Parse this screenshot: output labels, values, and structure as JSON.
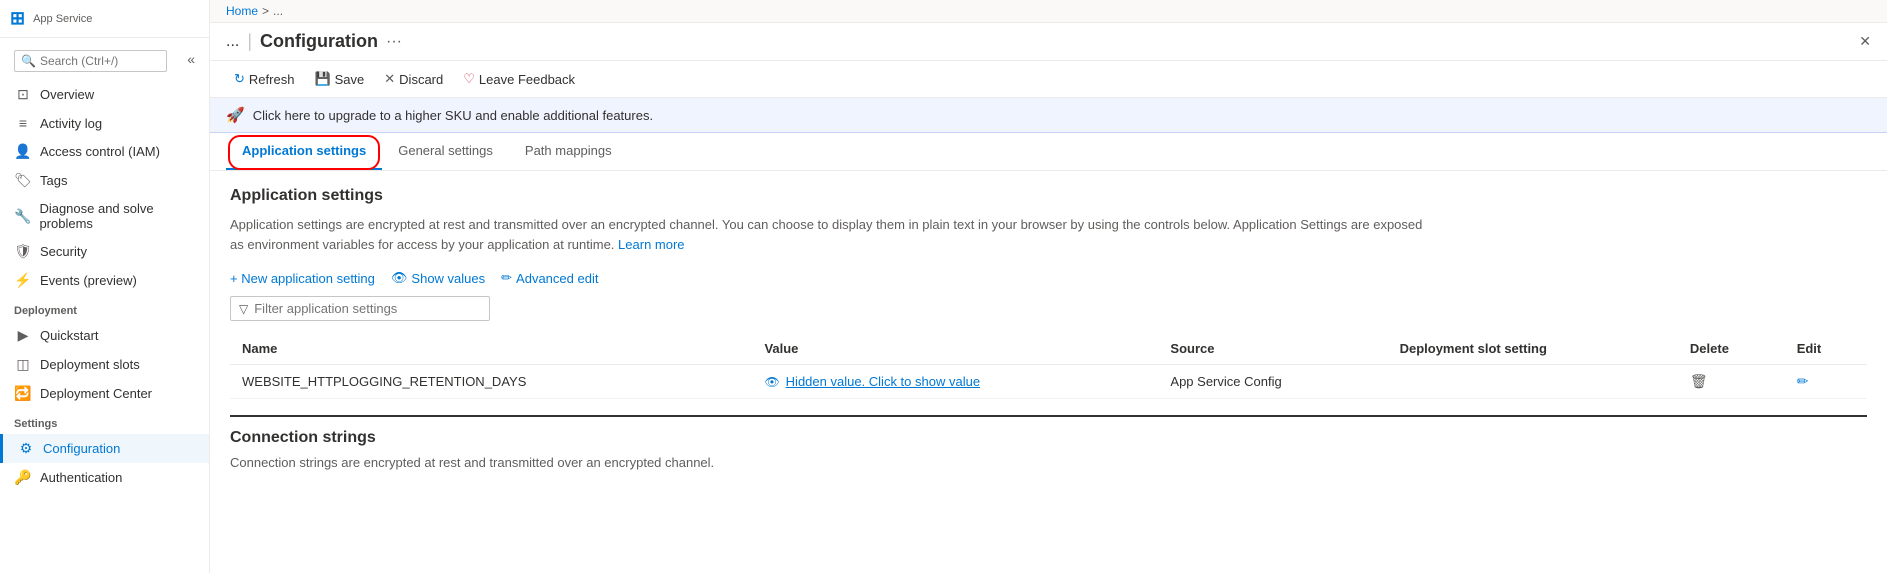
{
  "app": {
    "logo": "⊞",
    "service_label": "App Service",
    "close_label": "✕",
    "more_label": "···"
  },
  "breadcrumb": {
    "home": "Home",
    "separator": ">",
    "app_name": "..."
  },
  "page_title": {
    "app_name": "...",
    "pipe": "|",
    "title": "Configuration",
    "more": "···"
  },
  "toolbar": {
    "refresh_label": "Refresh",
    "save_label": "Save",
    "discard_label": "Discard",
    "leave_feedback_label": "Leave Feedback",
    "refresh_icon": "↻",
    "save_icon": "💾",
    "discard_icon": "✕",
    "feedback_icon": "♡"
  },
  "upgrade_banner": {
    "text": "Click here to upgrade to a higher SKU and enable additional features.",
    "icon": "🚀"
  },
  "sidebar": {
    "search_placeholder": "Search (Ctrl+/)",
    "items": [
      {
        "label": "Overview",
        "icon": "⊡"
      },
      {
        "label": "Activity log",
        "icon": "≡"
      },
      {
        "label": "Access control (IAM)",
        "icon": "👤"
      },
      {
        "label": "Tags",
        "icon": "🏷"
      },
      {
        "label": "Diagnose and solve problems",
        "icon": "🔧"
      },
      {
        "label": "Security",
        "icon": "🛡"
      },
      {
        "label": "Events (preview)",
        "icon": "⚡"
      }
    ],
    "deployment_section": "Deployment",
    "deployment_items": [
      {
        "label": "Quickstart",
        "icon": "▶"
      },
      {
        "label": "Deployment slots",
        "icon": "◫"
      },
      {
        "label": "Deployment Center",
        "icon": "🔁"
      }
    ],
    "settings_section": "Settings",
    "settings_items": [
      {
        "label": "Configuration",
        "icon": "⚙",
        "active": true
      },
      {
        "label": "Authentication",
        "icon": "🔑"
      }
    ]
  },
  "tabs": [
    {
      "label": "Application settings",
      "active": true
    },
    {
      "label": "General settings",
      "active": false
    },
    {
      "label": "Path mappings",
      "active": false
    }
  ],
  "app_settings_section": {
    "title": "Application settings",
    "description": "Application settings are encrypted at rest and transmitted over an encrypted channel. You can choose to display them in plain text in your browser by using the controls below. Application Settings are exposed as environment variables for access by your application at runtime.",
    "learn_more": "Learn more",
    "new_setting_label": "+ New application setting",
    "show_values_label": "Show values",
    "advanced_edit_label": "Advanced edit",
    "filter_placeholder": "Filter application settings",
    "table": {
      "columns": [
        "Name",
        "Value",
        "Source",
        "Deployment slot setting",
        "Delete",
        "Edit"
      ],
      "rows": [
        {
          "name": "WEBSITE_HTTPLOGGING_RETENTION_DAYS",
          "value": "Hidden value. Click to show value",
          "source": "App Service Config",
          "slot_setting": "",
          "delete": "🗑",
          "edit": "✏"
        }
      ]
    }
  },
  "connection_strings_section": {
    "title": "Connection strings",
    "description": "Connection strings are encrypted at rest and transmitted over an encrypted channel."
  }
}
